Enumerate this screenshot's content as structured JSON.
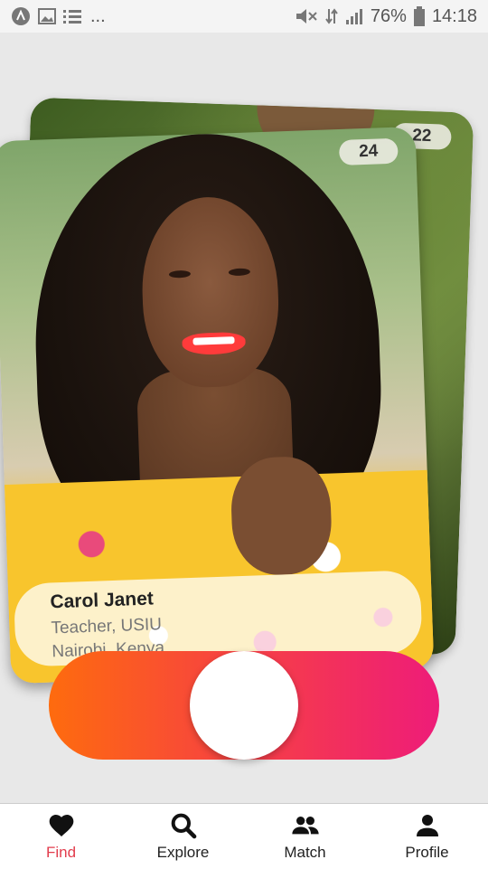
{
  "status_bar": {
    "dots": "...",
    "battery_percent": "76%",
    "time": "14:18"
  },
  "cards": {
    "back": {
      "badge": "22"
    },
    "front": {
      "badge": "24",
      "name": "Carol Janet",
      "occupation": "Teacher, USIU",
      "location": "Nairobi, Kenya"
    }
  },
  "nav": {
    "items": [
      {
        "label": "Find",
        "icon": "heart-icon",
        "active": true
      },
      {
        "label": "Explore",
        "icon": "search-icon",
        "active": false
      },
      {
        "label": "Match",
        "icon": "people-icon",
        "active": false
      },
      {
        "label": "Profile",
        "icon": "person-icon",
        "active": false
      }
    ]
  },
  "colors": {
    "accent": "#e23d4d",
    "gradient_start": "#fe6b0e",
    "gradient_end": "#ee1c79"
  }
}
